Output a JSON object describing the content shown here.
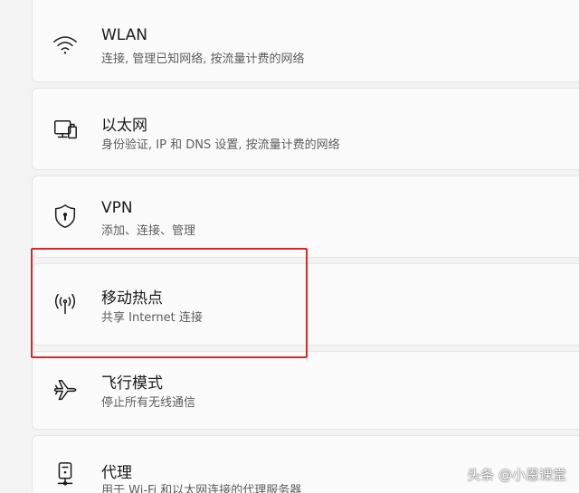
{
  "settings": {
    "items": [
      {
        "key": "wlan",
        "icon": "wifi-icon",
        "title": "WLAN",
        "subtitle": "连接, 管理已知网络, 按流量计费的网络"
      },
      {
        "key": "ethernet",
        "icon": "ethernet-icon",
        "title": "以太网",
        "subtitle": "身份验证, IP 和 DNS 设置, 按流量计费的网络"
      },
      {
        "key": "vpn",
        "icon": "shield-icon",
        "title": "VPN",
        "subtitle": "添加、连接、管理"
      },
      {
        "key": "hotspot",
        "icon": "hotspot-icon",
        "title": "移动热点",
        "subtitle": "共享 Internet 连接"
      },
      {
        "key": "airplane",
        "icon": "airplane-icon",
        "title": "飞行模式",
        "subtitle": "停止所有无线通信"
      },
      {
        "key": "proxy",
        "icon": "proxy-icon",
        "title": "代理",
        "subtitle": "用于 Wi-Fi 和以太网连接的代理服务器"
      }
    ]
  },
  "watermark": "头条 @小恩课堂",
  "colors": {
    "background": "#f3f3f3",
    "card": "#fbfbfb",
    "highlight_border": "#d62a2a"
  }
}
